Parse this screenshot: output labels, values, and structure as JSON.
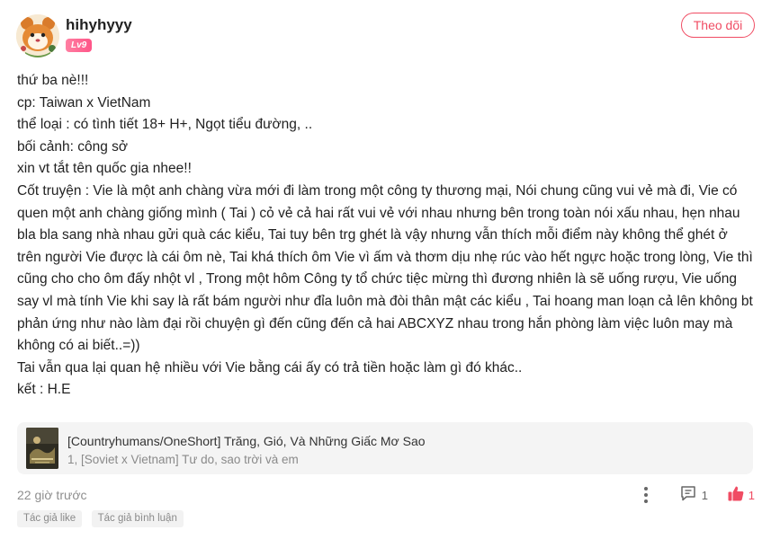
{
  "author": {
    "username": "hihyhyyy",
    "level": "Lv9",
    "follow_label": "Theo dõi"
  },
  "post": {
    "lines": [
      "thứ ba nè!!!",
      "cp: Taiwan x VietNam",
      "thể loại : có tình tiết 18+ H+, Ngọt tiểu đường, ..",
      "bối cảnh: công sở",
      "xin vt tắt tên quốc gia nhee!!",
      "Cốt truyện : Vie là một anh chàng vừa mới đi làm trong một công ty thương mại, Nói chung cũng vui vẻ mà đi, Vie có quen một anh chàng giống mình ( Tai ) cỏ vẻ cả hai rất vui vẻ với nhau nhưng bên trong toàn nói xấu nhau, hẹn nhau bla bla sang nhà nhau gửi quà các kiểu, Tai tuy bên trg ghét là vậy nhưng vẫn thích mỗi điểm này không thể ghét ở trên người Vie được là cái ôm nè, Tai khá thích ôm Vie vì ấm và thơm dịu nhẹ rúc vào hết ngực hoặc trong lòng, Vie thì cũng cho cho ôm đấy nhột vl , Trong một hôm Công ty tổ chức tiệc mừng thì đương nhiên là sẽ uống rượu, Vie uống say vl mà tính Vie khi say là rất bám người như đỉa luôn mà đòi thân mật các kiểu , Tai hoang man loạn cả lên không bt  phản ứng như nào làm đại rồi chuyện gì đến cũng đến cả hai ABCXYZ nhau trong hắn phòng làm việc luôn may mà không có ai biết..=))",
      "Tai vẫn qua lại quan hệ nhiều với Vie bằng cái ấy có trả tiền hoặc làm gì đó khác..",
      "kết : H.E"
    ]
  },
  "linked_work": {
    "title": "[Countryhumans/OneShort] Trăng, Gió, Và Những Giấc Mơ Sao",
    "subtitle": "1, [Soviet x Vietnam] Tư do, sao trời và em"
  },
  "footer": {
    "time": "22 giờ trước",
    "comment_count": "1",
    "like_count": "1"
  },
  "tags": [
    "Tác giả like",
    "Tác giả bình luận"
  ],
  "colors": {
    "accent": "#f04c63",
    "card_bg": "#f4f4f4",
    "muted_text": "#8e8e8e"
  },
  "icons": {
    "more": "more-vertical-icon",
    "comment": "comment-icon",
    "like": "thumbs-up-icon"
  }
}
